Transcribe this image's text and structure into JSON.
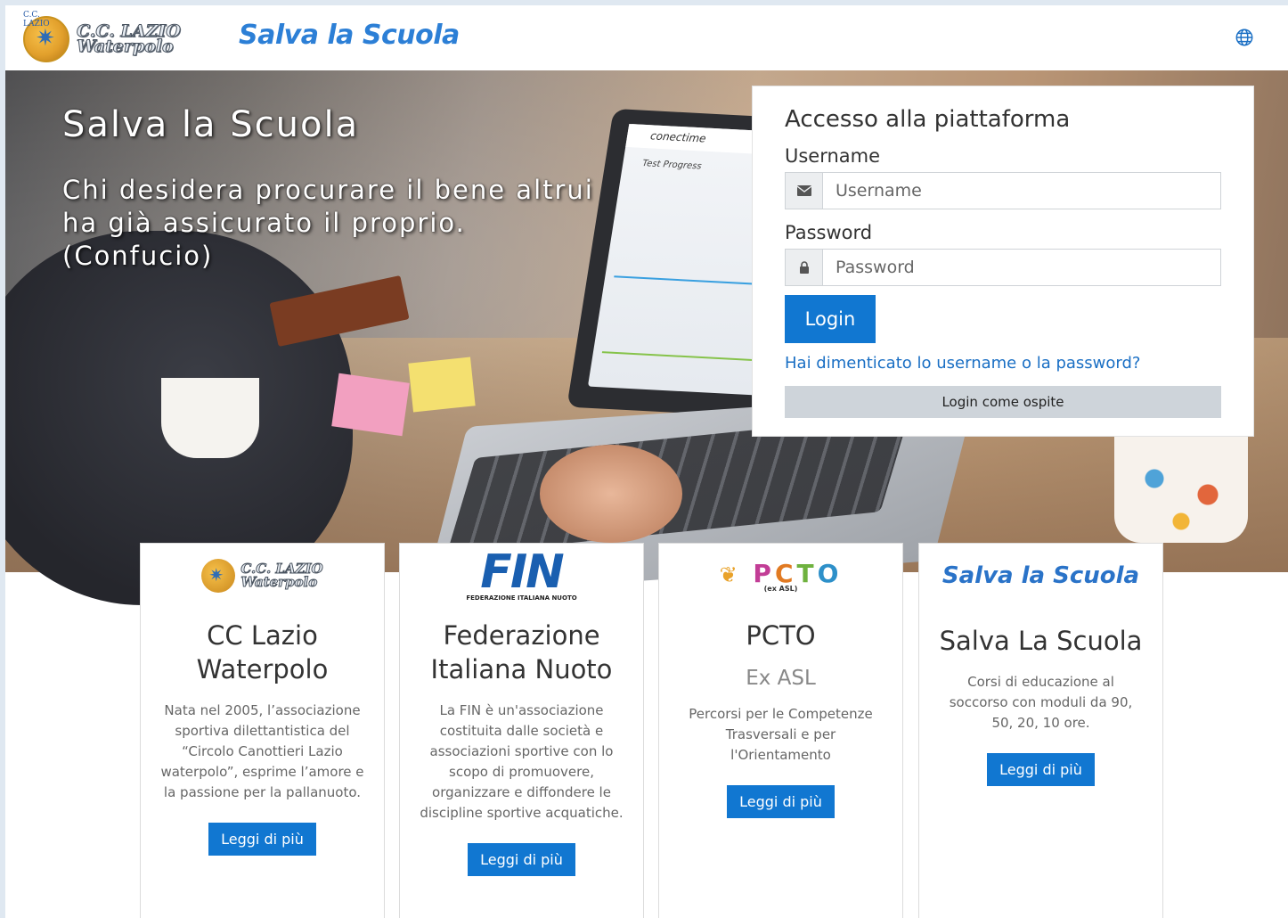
{
  "navbar": {
    "logo_text_line1": "C.C. LAZIO",
    "logo_text_line2": "Waterpolo",
    "logo_ring_text": "C.C. LAZIO",
    "brand_title": "Salva la Scuola",
    "language_icon": "globe-icon"
  },
  "hero": {
    "title": "Salva la Scuola",
    "quote": "Chi desidera procurare il bene altrui ha già assicurato il proprio. (Confucio)",
    "laptop_screen_brand": "conectime",
    "laptop_screen_heading": "Test Progress"
  },
  "login": {
    "heading": "Accesso alla piattaforma",
    "username_label": "Username",
    "username_placeholder": "Username",
    "password_label": "Password",
    "password_placeholder": "Password",
    "login_button": "Login",
    "forgot_link": "Hai dimenticato lo username o la password?",
    "guest_button": "Login come ospite",
    "username_icon": "envelope-icon",
    "password_icon": "lock-icon"
  },
  "cards": [
    {
      "logo_line1": "C.C. LAZIO",
      "logo_line2": "Waterpolo",
      "title": "CC Lazio Waterpolo",
      "subtitle": "",
      "text": "Nata nel 2005, l’associazione sportiva dilettantistica del “Circolo Canottieri Lazio waterpolo”, esprime l’amore e la passione per la pallanuoto.",
      "button": "Leggi di più"
    },
    {
      "logo_mark": "FIN",
      "logo_sub": "FEDERAZIONE ITALIANA NUOTO",
      "title": "Federazione Italiana Nuoto",
      "subtitle": "",
      "text": "La FIN è un'associazione costituita dalle società e associazioni sportive con lo scopo di promuovere, organizzare e diffondere le discipline sportive acquatiche.",
      "button": "Leggi di più"
    },
    {
      "logo_p": "P",
      "logo_c": "C",
      "logo_t": "T",
      "logo_o": "O",
      "logo_sub": "(ex ASL)",
      "title": "PCTO",
      "subtitle": "Ex ASL",
      "text": "Percorsi per le Competenze Trasversali e per l'Orientamento",
      "button": "Leggi di più"
    },
    {
      "logo_text": "Salva la Scuola",
      "title": "Salva La Scuola",
      "subtitle": "",
      "text": "Corsi di educazione al soccorso con moduli da 90, 50, 20, 10 ore.",
      "button": "Leggi di più"
    }
  ],
  "colors": {
    "primary": "#1177d1",
    "brand_blue": "#2c7fd6",
    "guest_button_bg": "#ced4da"
  }
}
